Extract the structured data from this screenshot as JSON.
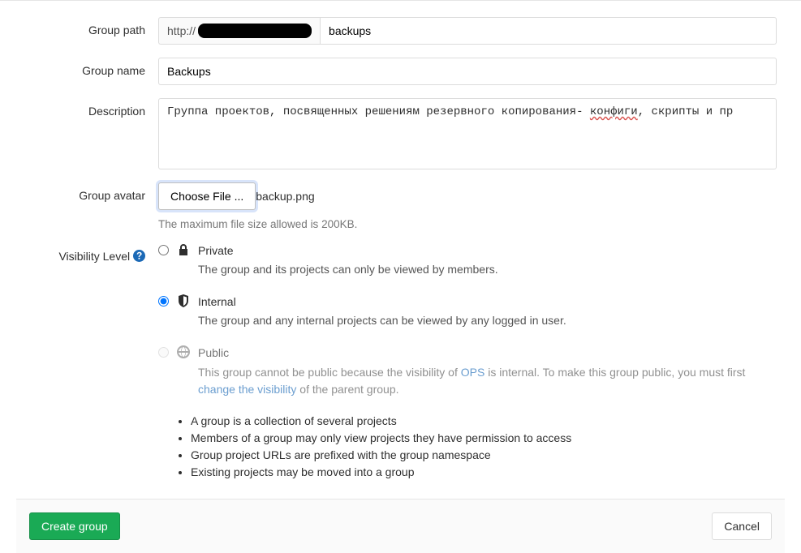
{
  "labels": {
    "group_path": "Group path",
    "group_name": "Group name",
    "description": "Description",
    "group_avatar": "Group avatar",
    "visibility_level": "Visibility Level"
  },
  "path": {
    "prefix": "http://",
    "value": "backups"
  },
  "name": "Backups",
  "description": {
    "before": "Группа проектов, посвященных решениям резервного копирования- ",
    "spelled": "конфиги",
    "after": ", скрипты и пр"
  },
  "avatar": {
    "choose_label": "Choose File ...",
    "filename": "backup.png",
    "hint": "The maximum file size allowed is 200KB."
  },
  "visibility": {
    "private": {
      "title": "Private",
      "desc": "The group and its projects can only be viewed by members."
    },
    "internal": {
      "title": "Internal",
      "desc": "The group and any internal projects can be viewed by any logged in user."
    },
    "public": {
      "title": "Public",
      "desc_part1": "This group cannot be public because the visibility of ",
      "link1": "OPS",
      "desc_part2": " is internal. To make this group public, you must first ",
      "link2": "change the visibility",
      "desc_part3": " of the parent group."
    }
  },
  "info_list": {
    "item1": "A group is a collection of several projects",
    "item2": "Members of a group may only view projects they have permission to access",
    "item3": "Group project URLs are prefixed with the group namespace",
    "item4": "Existing projects may be moved into a group"
  },
  "buttons": {
    "create": "Create group",
    "cancel": "Cancel"
  }
}
